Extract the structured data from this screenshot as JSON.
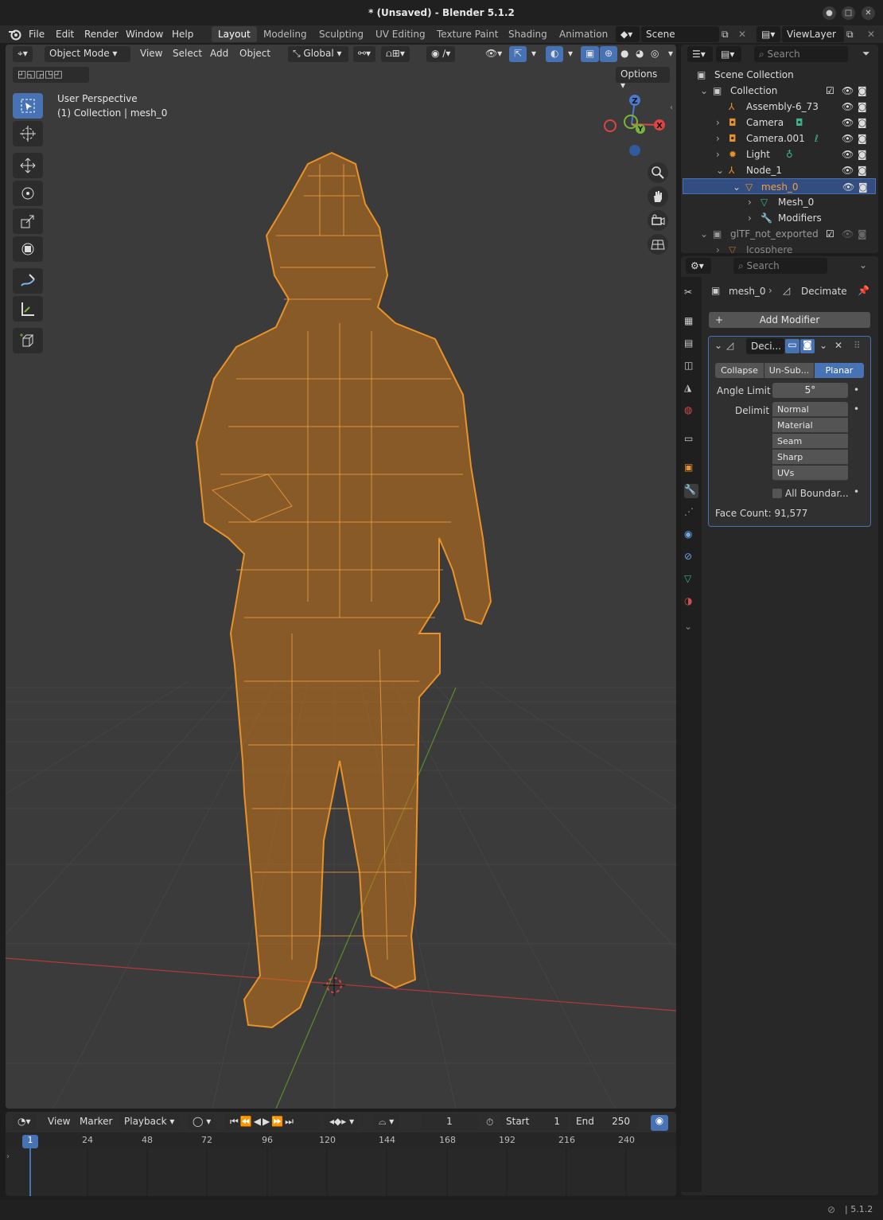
{
  "window": {
    "title": "* (Unsaved) - Blender 5.1.2"
  },
  "menu": {
    "items": [
      "File",
      "Edit",
      "Render",
      "Window",
      "Help"
    ],
    "workspaces": [
      "Layout",
      "Modeling",
      "Sculpting",
      "UV Editing",
      "Texture Paint",
      "Shading",
      "Animation"
    ],
    "active_workspace": "Layout",
    "scene": "Scene",
    "view_layer": "ViewLayer"
  },
  "viewport": {
    "mode": "Object Mode",
    "menus": [
      "View",
      "Select",
      "Add",
      "Object"
    ],
    "transform_orientation": "Global",
    "options_label": "Options",
    "overlay_text_line1": "User Perspective",
    "overlay_text_line2": "(1) Collection | mesh_0",
    "gizmo_axes": {
      "z": "Z",
      "y": "Y",
      "x": "X"
    },
    "wire_color": "#e08a1e"
  },
  "outliner": {
    "search_placeholder": "Search",
    "rows": [
      {
        "label": "Scene Collection"
      },
      {
        "label": "Collection"
      },
      {
        "label": "Assembly-6_73"
      },
      {
        "label": "Camera"
      },
      {
        "label": "Camera.001"
      },
      {
        "label": "Light"
      },
      {
        "label": "Node_1"
      },
      {
        "label": "mesh_0"
      },
      {
        "label": "Mesh_0"
      },
      {
        "label": "Modifiers"
      },
      {
        "label": "glTF_not_exported"
      },
      {
        "label": "Icosphere"
      }
    ]
  },
  "properties": {
    "search_placeholder": "Search",
    "breadcrumb_object": "mesh_0",
    "breadcrumb_modifier": "Decimate",
    "add_modifier": "Add Modifier",
    "modifier_name": "Deci...",
    "modes": [
      "Collapse",
      "Un-Sub...",
      "Planar"
    ],
    "active_mode": "Planar",
    "angle_limit_label": "Angle Limit",
    "angle_limit_value": "5°",
    "delimit_label": "Delimit",
    "delimit_items": [
      "Normal",
      "Material",
      "Seam",
      "Sharp",
      "UVs"
    ],
    "all_boundaries_label": "All Boundar...",
    "face_count": "Face Count: 91,577"
  },
  "timeline": {
    "menus": [
      "View",
      "Marker",
      "Playback"
    ],
    "current_frame": "1",
    "start_label": "Start",
    "start_value": "1",
    "end_label": "End",
    "end_value": "250",
    "ticks": [
      "1",
      "24",
      "48",
      "72",
      "96",
      "120",
      "144",
      "168",
      "192",
      "216",
      "240"
    ]
  },
  "status": {
    "version": "5.1.2"
  }
}
